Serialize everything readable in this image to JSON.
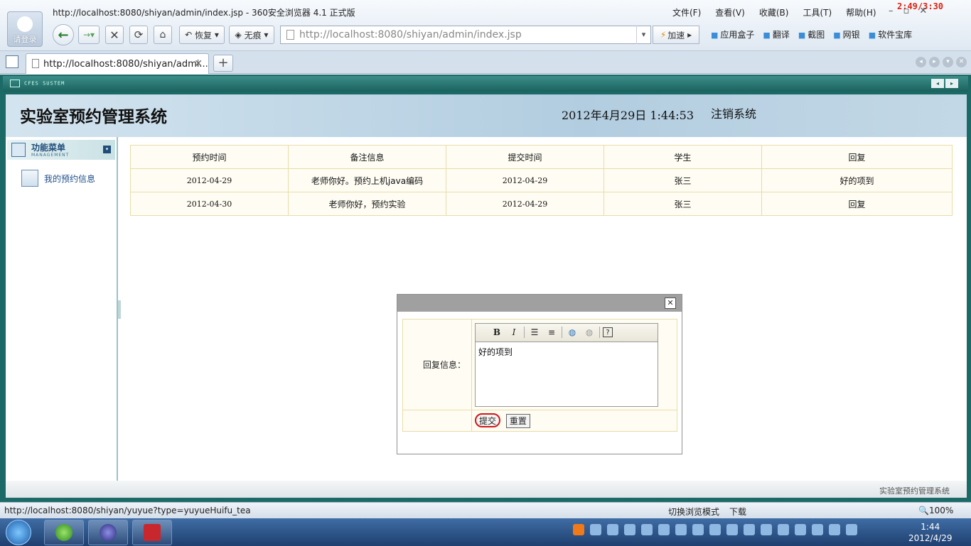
{
  "browser": {
    "window_title": "http://localhost:8080/shiyan/admin/index.jsp - 360安全浏览器 4.1 正式版",
    "login_label": "请登录",
    "menu": [
      "文件(F)",
      "查看(V)",
      "收藏(B)",
      "工具(T)",
      "帮助(H)"
    ],
    "timer": "2:49/3:30",
    "restore_label": "恢复",
    "traceless_label": "无痕",
    "address": "http://localhost:8080/shiyan/admin/index.jsp",
    "address_host": "localhost",
    "speed_label": "加速",
    "right_tools": [
      "应用盒子",
      "翻译",
      "截图",
      "网银",
      "软件宝库"
    ],
    "tab_title": "http://localhost:8080/shiyan/admi...",
    "status_url": "http://localhost:8080/shiyan/yuyue?type=yuyueHuifu_tea",
    "status_right": [
      "切换浏览模式",
      "下载"
    ],
    "zoom": "100%"
  },
  "app": {
    "brand": "CFES SUSTEM",
    "title": "实验室预约管理系统",
    "datetime": "2012年4月29日  1:44:53",
    "logout": "注销系统",
    "footer": "实验室预约管理系统"
  },
  "sidebar": {
    "heading": "功能菜单",
    "subheading": "MANAGEMENT",
    "items": [
      {
        "label": "我的预约信息"
      }
    ]
  },
  "table": {
    "headers": [
      "预约时间",
      "备注信息",
      "提交时间",
      "学生",
      "回复"
    ],
    "rows": [
      [
        "2012-04-29",
        "老师你好。预约上机java编码",
        "2012-04-29",
        "张三",
        "好的项到"
      ],
      [
        "2012-04-30",
        "老师你好，预约实验",
        "2012-04-29",
        "张三",
        "回复"
      ]
    ]
  },
  "dialog": {
    "reply_label": "回复信息：",
    "editor_text": "好的项到",
    "submit_label": "提交",
    "reset_label": "重置"
  },
  "taskbar": {
    "time": "1:44",
    "date": "2012/4/29"
  }
}
